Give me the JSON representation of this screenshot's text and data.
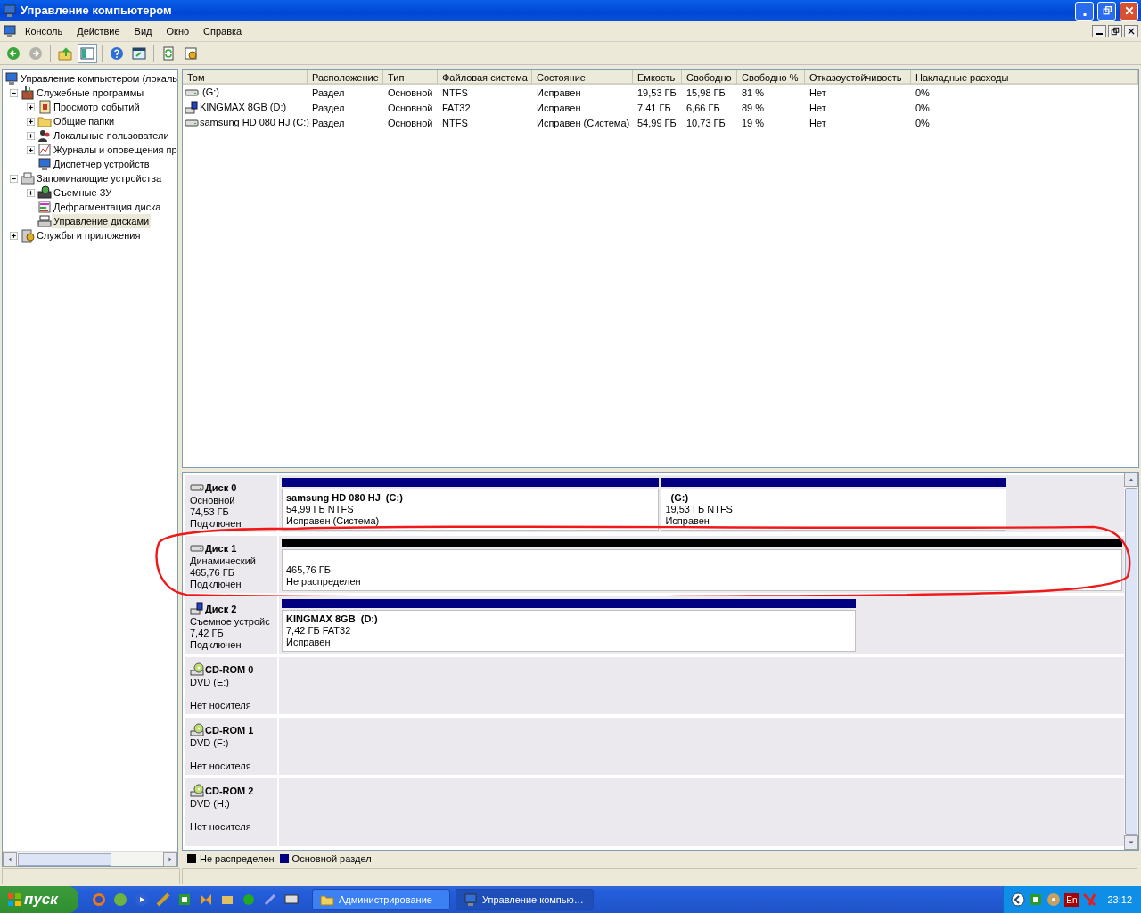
{
  "window": {
    "title": "Управление компьютером"
  },
  "menu": [
    "Консоль",
    "Действие",
    "Вид",
    "Окно",
    "Справка"
  ],
  "toolbar": [
    {
      "kind": "back",
      "disabled": false,
      "selected": false
    },
    {
      "kind": "forward",
      "disabled": true,
      "selected": false
    },
    {
      "kind": "up",
      "disabled": false,
      "selected": false
    },
    {
      "kind": "tree",
      "disabled": false,
      "selected": true
    },
    {
      "kind": "help",
      "disabled": false,
      "selected": false
    },
    {
      "kind": "window",
      "disabled": false,
      "selected": false
    },
    {
      "kind": "refresh",
      "disabled": false,
      "selected": false
    },
    {
      "kind": "properties",
      "disabled": false,
      "selected": false
    }
  ],
  "tree": [
    {
      "label": "Управление компьютером (локаль",
      "kind": "computer",
      "selected": false,
      "children": [
        {
          "label": "Служебные программы",
          "kind": "tools",
          "expanded": true,
          "selected": false,
          "children": [
            {
              "label": "Просмотр событий",
              "kind": "events",
              "expanded": false,
              "selected": false
            },
            {
              "label": "Общие папки",
              "kind": "folder",
              "expanded": false,
              "selected": false
            },
            {
              "label": "Локальные пользователи",
              "kind": "users",
              "expanded": false,
              "selected": false
            },
            {
              "label": "Журналы и оповещения пр",
              "kind": "logs",
              "expanded": false,
              "selected": false
            },
            {
              "label": "Диспетчер устройств",
              "kind": "computer",
              "selected": false
            }
          ]
        },
        {
          "label": "Запоминающие устройства",
          "kind": "storage",
          "expanded": true,
          "selected": false,
          "children": [
            {
              "label": "Съемные ЗУ",
              "kind": "removable",
              "expanded": false,
              "selected": false
            },
            {
              "label": "Дефрагментация диска",
              "kind": "defrag",
              "selected": false
            },
            {
              "label": "Управление дисками",
              "kind": "disks",
              "selected": true
            }
          ]
        },
        {
          "label": "Службы и приложения",
          "kind": "services",
          "expanded": false,
          "selected": false
        }
      ]
    }
  ],
  "table": {
    "columns": [
      "Том",
      "Расположение",
      "Тип",
      "Файловая система",
      "Состояние",
      "Емкость",
      "Свободно",
      "Свободно %",
      "Отказоустойчивость",
      "Накладные расходы"
    ],
    "rows": [
      {
        "kind": "fixed",
        "cells": [
          " (G:)",
          "Раздел",
          "Основной",
          "NTFS",
          "Исправен",
          "19,53 ГБ",
          "15,98 ГБ",
          "81 %",
          "Нет",
          "0%"
        ]
      },
      {
        "kind": "removable",
        "cells": [
          "KINGMAX 8GB (D:)",
          "Раздел",
          "Основной",
          "FAT32",
          "Исправен",
          "7,41 ГБ",
          "6,66 ГБ",
          "89 %",
          "Нет",
          "0%"
        ]
      },
      {
        "kind": "fixed",
        "cells": [
          "samsung HD 080 HJ (C:)",
          "Раздел",
          "Основной",
          "NTFS",
          "Исправен (Система)",
          "54,99 ГБ",
          "10,73 ГБ",
          "19 %",
          "Нет",
          "0%"
        ]
      }
    ]
  },
  "disks": [
    {
      "kind": "fixed",
      "name": "Диск 0",
      "type": "Основной",
      "size": "74,53 ГБ",
      "status": "Подключен",
      "circled": false,
      "partitions": [
        {
          "kind": "primary",
          "title": "samsung HD 080 HJ  (C:)",
          "size": "54,99 ГБ NTFS",
          "status": "Исправен (Система)"
        },
        {
          "kind": "primary",
          "title": "  (G:)",
          "size": "19,53 ГБ NTFS",
          "status": "Исправен"
        }
      ]
    },
    {
      "kind": "fixed",
      "name": "Диск 1",
      "type": "Динамический",
      "size": "465,76 ГБ",
      "status": "Подключен",
      "circled": true,
      "partitions": [
        {
          "kind": "unallocated",
          "size": "465,76 ГБ",
          "status": "Не распределен"
        }
      ]
    },
    {
      "kind": "removable",
      "name": "Диск 2",
      "type": "Съемное устройс",
      "size": "7,42 ГБ",
      "status": "Подключен",
      "circled": false,
      "partitions": [
        {
          "kind": "primary",
          "title": "KINGMAX 8GB  (D:)",
          "size": "7,42 ГБ FAT32",
          "status": "Исправен"
        }
      ]
    },
    {
      "kind": "cdrom",
      "name": "CD-ROM 0",
      "type": "DVD (E:)",
      "status": "Нет носителя",
      "circled": false
    },
    {
      "kind": "cdrom",
      "name": "CD-ROM 1",
      "type": "DVD (F:)",
      "status": "Нет носителя",
      "circled": false
    },
    {
      "kind": "cdrom",
      "name": "CD-ROM 2",
      "type": "DVD (H:)",
      "status": "Нет носителя",
      "circled": false
    }
  ],
  "legend": [
    {
      "kind": "unallocated",
      "label": "Не распределен"
    },
    {
      "kind": "primary",
      "label": "Основной раздел"
    }
  ],
  "taskbar": {
    "start": "пуск",
    "tasks": [
      {
        "label": "Администрирование",
        "kind": "folder",
        "selected": false
      },
      {
        "label": "Управление компью…",
        "kind": "computer",
        "selected": true
      }
    ],
    "language": "En",
    "clock": "23:12"
  }
}
